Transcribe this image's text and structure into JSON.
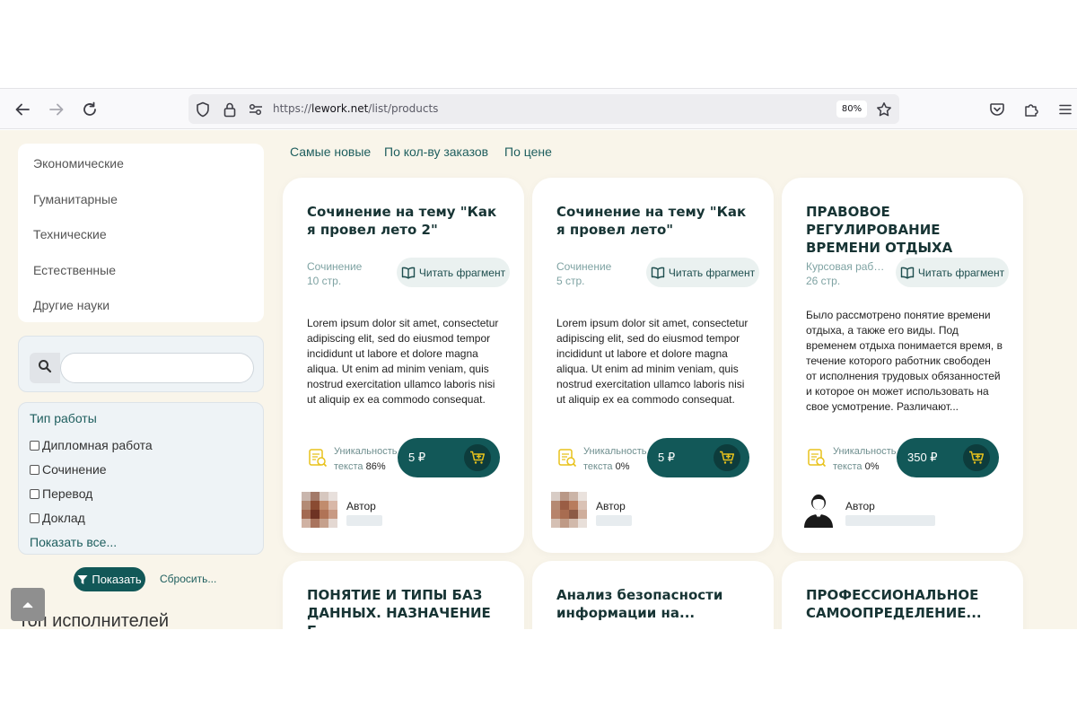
{
  "browser": {
    "url_prefix": "https://",
    "url_domain": "lework.net",
    "url_path": "/list/products",
    "zoom": "80%"
  },
  "sidebar": {
    "categories": [
      "Экономические",
      "Гуманитарные",
      "Технические",
      "Естественные",
      "Другие науки"
    ],
    "filter": {
      "title": "Тип работы",
      "options": [
        "Дипломная работа",
        "Сочинение",
        "Перевод",
        "Доклад"
      ],
      "show_all": "Показать все..."
    },
    "show_button": "Показать",
    "reset_link": "Сбросить...",
    "top_title": "Топ исполнителей"
  },
  "sort": [
    "Самые новые",
    "По кол-ву заказов",
    "По цене"
  ],
  "cards": [
    {
      "title": "Сочинение на тему \"Как я провел лето 2\"",
      "type": "Сочинение",
      "pages": "10 стр.",
      "read_label": "Читать фрагмент",
      "description": "Lorem ipsum dolor sit amet, consectetur adipiscing elit, sed do eiusmod tempor incididunt ut labore et dolore magna aliqua. Ut enim ad minim veniam, quis nostrud exercitation ullamco laboris nisi ut aliquip ex ea commodo consequat.",
      "uniq_label": "Уникальность",
      "uniq_prefix": "текста",
      "uniq_value": "86%",
      "price": "5 ₽",
      "author_label": "Автор"
    },
    {
      "title": "Сочинение на тему \"Как я провел лето\"",
      "type": "Сочинение",
      "pages": "5 стр.",
      "read_label": "Читать фрагмент",
      "description": "Lorem ipsum dolor sit amet, consectetur adipiscing elit, sed do eiusmod tempor incididunt ut labore et dolore magna aliqua. Ut enim ad minim veniam, quis nostrud exercitation ullamco laboris nisi ut aliquip ex ea commodo consequat.",
      "uniq_label": "Уникальность",
      "uniq_prefix": "текста",
      "uniq_value": "0%",
      "price": "5 ₽",
      "author_label": "Автор"
    },
    {
      "title": "ПРАВОВОЕ РЕГУЛИРОВАНИЕ ВРЕМЕНИ ОТДЫХА",
      "type": "Курсовая работа",
      "pages": "26 стр.",
      "read_label": "Читать фрагмент",
      "description": "Было рассмотрено понятие времени отдыха, а также его виды. Под временем отдыха понимается время, в течение которого работник свободен от исполнения трудовых обязанностей и которое он может использовать на свое усмотрение. Различают...",
      "uniq_label": "Уникальность",
      "uniq_prefix": "текста",
      "uniq_value": "0%",
      "price": "350 ₽",
      "author_label": "Автор"
    },
    {
      "title": "ПОНЯТИЕ И ТИПЫ БАЗ ДАННЫХ. НАЗНАЧЕНИЕ Б..."
    },
    {
      "title": "Анализ безопасности информации на..."
    },
    {
      "title": "ПРОФЕССИОНАЛЬНОЕ САМООПРЕДЕЛЕНИЕ..."
    }
  ],
  "colors": {
    "accent": "#125858",
    "page_bg": "#f9f5ea",
    "uniq_icon": "#e8c21c"
  },
  "icons": [
    "back-arrow-icon",
    "forward-arrow-icon",
    "reload-icon",
    "shield-icon",
    "lock-icon",
    "permissions-icon",
    "star-icon",
    "pocket-icon",
    "extensions-icon",
    "menu-icon",
    "search-icon",
    "filter-icon",
    "book-icon",
    "uniqueness-icon",
    "cart-plus-icon",
    "chevron-up-icon"
  ]
}
